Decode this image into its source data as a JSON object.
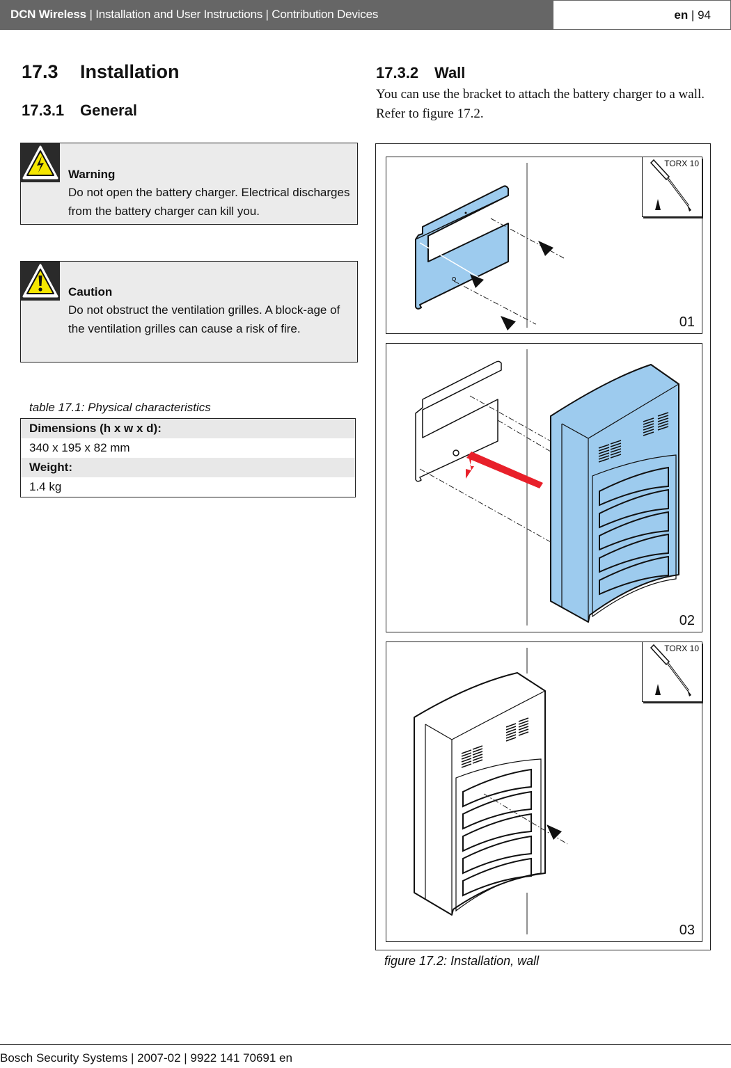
{
  "header": {
    "product": "DCN Wireless",
    "sep1": " | ",
    "doc_type": "Installation and User Instructions",
    "sep2": " | ",
    "section": "Contribution Devices",
    "lang": "en",
    "page_sep": " | ",
    "page": "94"
  },
  "section_17_3": {
    "num": "17.3",
    "title": "Installation"
  },
  "section_17_3_1": {
    "num": "17.3.1",
    "title": "General"
  },
  "warning": {
    "icon": "electric-hazard-icon",
    "title": "Warning",
    "text": "Do not open the battery charger. Electrical discharges from the battery charger can kill you."
  },
  "caution": {
    "icon": "exclamation-warning-icon",
    "title": "Caution",
    "text": "Do not obstruct the ventilation grilles. A block-age of the ventilation grilles can cause a risk of fire."
  },
  "table": {
    "caption": "table 17.1: Physical characteristics",
    "rows": [
      {
        "label": "Dimensions (h x w x d):",
        "value": "340 x 195 x 82 mm"
      },
      {
        "label": "Weight:",
        "value": "1.4 kg"
      }
    ]
  },
  "section_17_3_2": {
    "num": "17.3.2",
    "title": "Wall",
    "text": "You can use the bracket to attach the battery charger to a wall. Refer to figure 17.2."
  },
  "figure": {
    "caption": "figure 17.2: Installation, wall",
    "panels": [
      {
        "number": "01",
        "tool": "TORX 10"
      },
      {
        "number": "02"
      },
      {
        "number": "03",
        "tool": "TORX 10"
      }
    ],
    "colors": {
      "bracket": "#9dcbee",
      "arrow_red": "#e8202a"
    }
  },
  "footer": {
    "company": "Bosch Security Systems",
    "sep1": " | ",
    "date": "2007-02",
    "sep2": " | ",
    "doc_number": "9922 141 70691 en"
  }
}
